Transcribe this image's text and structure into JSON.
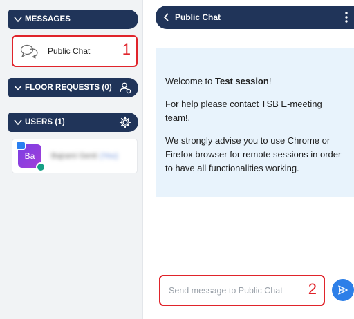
{
  "sidebar": {
    "messages_header": "MESSAGES",
    "public_chat_label": "Public Chat",
    "annotation_1": "1",
    "floor_requests_header": "FLOOR REQUESTS (0)",
    "users_header": "USERS (1)",
    "user": {
      "avatar_initials": "Ba",
      "name": "Bajrami Genti",
      "role": "(You)"
    }
  },
  "chat": {
    "title": "Public Chat",
    "welcome": {
      "line1_prefix": "Welcome to ",
      "line1_session": "Test session",
      "line1_suffix": "!",
      "line2_prefix": "For ",
      "line2_link1": "help",
      "line2_middle": " please contact ",
      "line2_link2": "TSB E-meeting team!",
      "line2_suffix": ".",
      "line3": "We strongly advise you to use Chrome or Firefox browser for remote sessions in order to have all functionalities working."
    },
    "input_placeholder": "Send message to Public Chat",
    "annotation_2": "2"
  },
  "colors": {
    "header_bg": "#203459",
    "highlight_red": "#e0242b",
    "welcome_bg": "#e8f3fc",
    "send_blue": "#2d7fe8"
  }
}
